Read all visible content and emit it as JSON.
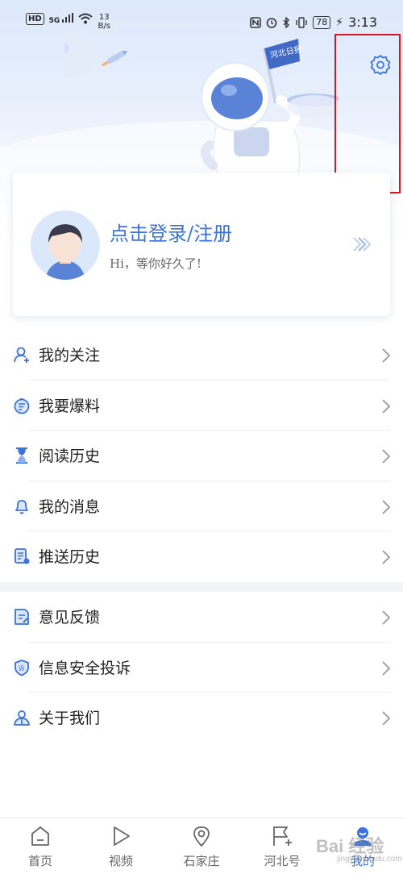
{
  "status_bar": {
    "hd": "HD",
    "signal": "5G",
    "net_speed_value": "13",
    "net_speed_unit": "B/s",
    "battery": "78",
    "time": "3:13"
  },
  "login": {
    "title": "点击登录/注册",
    "subtitle": "Hi，等你好久了!"
  },
  "menu_group_1": [
    {
      "label": "我的关注",
      "icon": "user-follow-icon"
    },
    {
      "label": "我要爆料",
      "icon": "report-icon"
    },
    {
      "label": "阅读历史",
      "icon": "hourglass-icon"
    },
    {
      "label": "我的消息",
      "icon": "bell-icon"
    },
    {
      "label": "推送历史",
      "icon": "push-history-icon"
    }
  ],
  "menu_group_2": [
    {
      "label": "意见反馈",
      "icon": "feedback-icon"
    },
    {
      "label": "信息安全投诉",
      "icon": "shield-icon"
    },
    {
      "label": "关于我们",
      "icon": "about-us-icon"
    }
  ],
  "bottom_nav": [
    {
      "label": "首页",
      "icon": "home-icon"
    },
    {
      "label": "视频",
      "icon": "play-icon"
    },
    {
      "label": "石家庄",
      "icon": "location-pin-icon"
    },
    {
      "label": "河北号",
      "icon": "flag-plus-icon"
    },
    {
      "label": "我的",
      "icon": "profile-icon",
      "active": true
    }
  ],
  "watermark": {
    "text": "Bai 经验",
    "sub": "jingyan.baidu.com"
  },
  "colors": {
    "accent": "#3b73d8",
    "highlight_box": "#e0141a"
  }
}
